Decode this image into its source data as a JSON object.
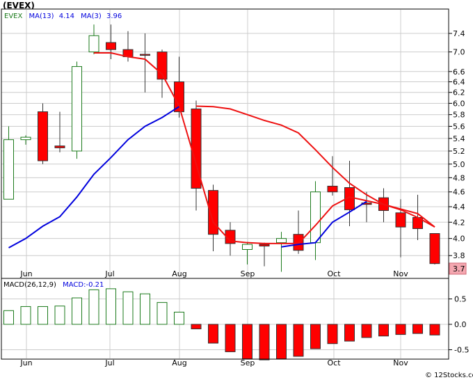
{
  "title": "(EVEX)",
  "price_legend": {
    "symbol": "EVEX",
    "ma13_label": "MA(13)",
    "ma13_value": "4.14",
    "ma3_label": "MA(3)",
    "ma3_value": "3.96"
  },
  "macd_legend": {
    "label": "MACD(26,12,9)",
    "value_label": "MACD:-0.21"
  },
  "last_price_label": "3.7",
  "credit": "© 12Stocks.com",
  "colors": {
    "up": "#1b7a1b",
    "down": "#ff0000",
    "ma13": "#0000dd",
    "ma3": "#ee1111",
    "grid": "#cccccc",
    "last_box": "#f4a7b0"
  },
  "chart_data": [
    {
      "type": "candlestick",
      "title": "(EVEX)",
      "x_labels": [
        "Jun",
        "Jul",
        "Aug",
        "Sep",
        "Oct",
        "Nov"
      ],
      "y_ticks": [
        3.8,
        4.0,
        4.2,
        4.4,
        4.6,
        4.8,
        5.0,
        5.2,
        5.4,
        5.6,
        5.8,
        6.0,
        6.2,
        6.4,
        6.6,
        7.0,
        7.4
      ],
      "y_scale": "log",
      "ylim": [
        3.6,
        7.85
      ],
      "candles": [
        {
          "o": 4.5,
          "h": 5.6,
          "l": 4.5,
          "c": 5.38
        },
        {
          "o": 5.38,
          "h": 5.45,
          "l": 5.3,
          "c": 5.42
        },
        {
          "o": 5.85,
          "h": 6.0,
          "l": 5.0,
          "c": 5.05
        },
        {
          "o": 5.28,
          "h": 5.85,
          "l": 5.18,
          "c": 5.25
        },
        {
          "o": 5.2,
          "h": 6.8,
          "l": 5.08,
          "c": 6.7
        },
        {
          "o": 7.0,
          "h": 7.6,
          "l": 6.95,
          "c": 7.35
        },
        {
          "o": 7.2,
          "h": 7.6,
          "l": 6.85,
          "c": 7.05
        },
        {
          "o": 7.05,
          "h": 7.45,
          "l": 6.8,
          "c": 6.9
        },
        {
          "o": 6.95,
          "h": 7.4,
          "l": 6.2,
          "c": 6.93
        },
        {
          "o": 7.0,
          "h": 7.05,
          "l": 6.1,
          "c": 6.45
        },
        {
          "o": 6.4,
          "h": 6.9,
          "l": 5.75,
          "c": 5.85
        },
        {
          "o": 5.9,
          "h": 6.05,
          "l": 4.35,
          "c": 4.65
        },
        {
          "o": 4.62,
          "h": 4.7,
          "l": 3.85,
          "c": 4.05
        },
        {
          "o": 4.1,
          "h": 4.2,
          "l": 3.8,
          "c": 3.94
        },
        {
          "o": 3.87,
          "h": 3.96,
          "l": 3.7,
          "c": 3.93
        },
        {
          "o": 3.93,
          "h": 3.95,
          "l": 3.68,
          "c": 3.91
        },
        {
          "o": 3.95,
          "h": 4.08,
          "l": 3.62,
          "c": 4.0
        },
        {
          "o": 4.05,
          "h": 4.35,
          "l": 3.82,
          "c": 3.86
        },
        {
          "o": 3.95,
          "h": 4.75,
          "l": 3.75,
          "c": 4.6
        },
        {
          "o": 4.68,
          "h": 5.12,
          "l": 4.55,
          "c": 4.6
        },
        {
          "o": 4.66,
          "h": 5.05,
          "l": 4.15,
          "c": 4.36
        },
        {
          "o": 4.45,
          "h": 4.6,
          "l": 4.2,
          "c": 4.43
        },
        {
          "o": 4.52,
          "h": 4.65,
          "l": 4.2,
          "c": 4.35
        },
        {
          "o": 4.32,
          "h": 4.5,
          "l": 3.78,
          "c": 4.14
        },
        {
          "o": 4.26,
          "h": 4.56,
          "l": 3.98,
          "c": 4.12
        },
        {
          "o": 4.06,
          "h": 4.06,
          "l": 3.7,
          "c": 3.71
        }
      ],
      "series": [
        {
          "name": "MA(13)",
          "values": [
            null,
            null,
            null,
            null,
            null,
            null,
            null,
            null,
            null,
            null,
            null,
            5.95,
            5.94,
            5.9,
            5.8,
            5.7,
            5.62,
            5.49,
            5.22,
            4.95,
            4.72,
            4.56,
            4.43,
            4.37,
            4.31,
            4.14
          ]
        },
        {
          "name": "MA(3)",
          "values": [
            3.89,
            4.0,
            4.15,
            4.27,
            4.53,
            4.85,
            5.1,
            5.38,
            5.6,
            5.75,
            5.94,
            null,
            null,
            null,
            null,
            null,
            3.9,
            3.93,
            3.95,
            4.2,
            4.33,
            4.47,
            null,
            null,
            null,
            null
          ]
        }
      ],
      "ma3_red_tail": [
        6.98,
        6.98,
        6.9,
        6.85,
        6.55,
        5.95,
        5.0,
        4.2,
        3.97,
        3.95,
        3.94,
        3.94,
        3.94,
        4.16,
        4.41,
        4.53,
        4.48,
        4.43,
        4.36,
        4.26,
        4.14
      ]
    },
    {
      "type": "bar",
      "title": "MACD(26,12,9)",
      "x_labels": [
        "Jun",
        "Jul",
        "Aug",
        "Sep",
        "Oct",
        "Nov"
      ],
      "y_ticks": [
        0.5,
        0.0,
        -0.5
      ],
      "ylim": [
        -0.68,
        0.8
      ],
      "values": [
        0.27,
        0.35,
        0.35,
        0.36,
        0.52,
        0.68,
        0.7,
        0.64,
        0.6,
        0.43,
        0.24,
        -0.09,
        -0.37,
        -0.54,
        -0.68,
        -0.7,
        -0.68,
        -0.63,
        -0.48,
        -0.38,
        -0.33,
        -0.26,
        -0.23,
        -0.2,
        -0.18,
        -0.21
      ]
    }
  ]
}
